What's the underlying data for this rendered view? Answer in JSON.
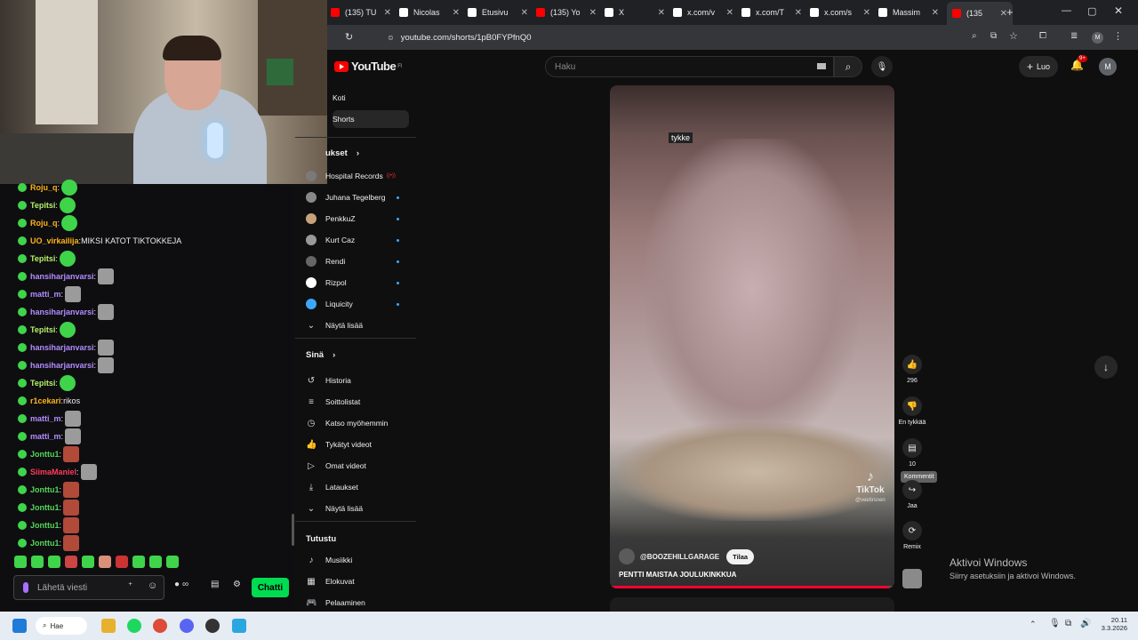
{
  "tabs": [
    {
      "label": "(135) TU",
      "icon": "youtube-icon",
      "color": "#ff0000"
    },
    {
      "label": "Nicolas",
      "icon": "x-icon",
      "color": "#ffffff"
    },
    {
      "label": "Etusivu",
      "icon": "x-icon",
      "color": "#ffffff"
    },
    {
      "label": "(135) Yo",
      "icon": "youtube-icon",
      "color": "#ff0000"
    },
    {
      "label": "X",
      "icon": "x-icon",
      "color": "#ffffff"
    },
    {
      "label": "x.com/v",
      "icon": "x-icon",
      "color": "#ffffff"
    },
    {
      "label": "x.com/T",
      "icon": "x-icon",
      "color": "#ffffff"
    },
    {
      "label": "x.com/s",
      "icon": "x-icon",
      "color": "#ffffff"
    },
    {
      "label": "Massim",
      "icon": "x-icon",
      "color": "#ffffff"
    },
    {
      "label": "(135",
      "icon": "youtube-icon",
      "color": "#ff0000"
    }
  ],
  "address": {
    "url": "youtube.com/shorts/1pB0FYPfnQ0"
  },
  "youtube": {
    "logo": "YouTube",
    "region": "FI",
    "search_placeholder": "Haku",
    "create_label": "Luo",
    "notifications": "9+",
    "avatar_letter": "M",
    "nav": [
      {
        "label": "Koti"
      },
      {
        "label": "Shorts"
      }
    ],
    "subscriptions_title": "ukset",
    "subscriptions": [
      {
        "label": "Hospital Records",
        "live": true
      },
      {
        "label": "Juhana Tegelberg",
        "live": false
      },
      {
        "label": "PenkkuZ",
        "live": false
      },
      {
        "label": "Kurt Caz",
        "live": false
      },
      {
        "label": "Rendi",
        "live": false
      },
      {
        "label": "Rizpol",
        "live": false
      },
      {
        "label": "Liquicity",
        "live": false
      }
    ],
    "show_more": "Näytä lisää",
    "you_title": "Sinä",
    "you_items": [
      {
        "label": "Historia",
        "icon": "history-icon",
        "glyph": "↺"
      },
      {
        "label": "Soittolistat",
        "icon": "playlists-icon",
        "glyph": "≡"
      },
      {
        "label": "Katso myöhemmin",
        "icon": "watch-later-icon",
        "glyph": "◷"
      },
      {
        "label": "Tykätyt videot",
        "icon": "liked-videos-icon",
        "glyph": "👍"
      },
      {
        "label": "Omat videot",
        "icon": "your-videos-icon",
        "glyph": "▷"
      },
      {
        "label": "Lataukset",
        "icon": "downloads-icon",
        "glyph": "⤓"
      },
      {
        "label": "Näytä lisää",
        "icon": "chevron-down-icon",
        "glyph": "⌄"
      }
    ],
    "explore_title": "Tutustu",
    "explore_items": [
      {
        "label": "Musiikki",
        "icon": "music-icon",
        "glyph": "♪"
      },
      {
        "label": "Elokuvat",
        "icon": "movies-icon",
        "glyph": "▦"
      },
      {
        "label": "Pelaaminen",
        "icon": "gaming-icon",
        "glyph": "🎮"
      }
    ],
    "short": {
      "overlay_text": "tykke",
      "channel": "@BOOZEHILLGARAGE",
      "subscribe": "Tilaa",
      "title": "PENTTI MAISTAA JOULUKINKKUA",
      "tiktok": "TikTok",
      "tiktok_handle": "@veetirsnen",
      "progress": 0.98,
      "likes": "296",
      "dislike_label": "En tykkää",
      "comments": "10",
      "comments_tooltip": "Kommentit",
      "share_label": "Jaa",
      "remix_label": "Remix"
    },
    "watermark": {
      "title": "Aktivoi Windows",
      "subtitle": "Siirry asetuksiin ja aktivoi Windows."
    }
  },
  "chat": {
    "messages": [
      {
        "user": "Roju_q",
        "color": "#ffb31a",
        "text": "",
        "emote": "green"
      },
      {
        "user": "Tepitsi",
        "color": "#b7f06a",
        "text": "",
        "emote": "green"
      },
      {
        "user": "Roju_q",
        "color": "#ffb31a",
        "text": "",
        "emote": "green"
      },
      {
        "user": "UO_virkailija",
        "color": "#ffb31a",
        "text": "MIKSI KATOT TIKTOKKEJA",
        "emote": ""
      },
      {
        "user": "Tepitsi",
        "color": "#b7f06a",
        "text": "",
        "emote": "green"
      },
      {
        "user": "hansiharjanvarsi",
        "color": "#b28cff",
        "text": "",
        "emote": "cat"
      },
      {
        "user": "matti_m",
        "color": "#b28cff",
        "text": "",
        "emote": "cat"
      },
      {
        "user": "hansiharjanvarsi",
        "color": "#b28cff",
        "text": "",
        "emote": "cat"
      },
      {
        "user": "Tepitsi",
        "color": "#b7f06a",
        "text": "",
        "emote": "green"
      },
      {
        "user": "hansiharjanvarsi",
        "color": "#b28cff",
        "text": "",
        "emote": "cat"
      },
      {
        "user": "hansiharjanvarsi",
        "color": "#b28cff",
        "text": "",
        "emote": "cat"
      },
      {
        "user": "Tepitsi",
        "color": "#b7f06a",
        "text": "",
        "emote": "green"
      },
      {
        "user": "r1cekari",
        "color": "#ffb31a",
        "text": "rikos",
        "emote": ""
      },
      {
        "user": "matti_m",
        "color": "#b28cff",
        "text": "",
        "emote": "cat"
      },
      {
        "user": "matti_m",
        "color": "#b28cff",
        "text": "",
        "emote": "cat"
      },
      {
        "user": "Jonttu1",
        "color": "#54d65a",
        "text": "",
        "emote": "face"
      },
      {
        "user": "SiimaManiel",
        "color": "#ff3b5c",
        "text": "",
        "emote": "cat"
      },
      {
        "user": "Jonttu1",
        "color": "#54d65a",
        "text": "",
        "emote": "face"
      },
      {
        "user": "Jonttu1",
        "color": "#54d65a",
        "text": "",
        "emote": "face"
      },
      {
        "user": "Jonttu1",
        "color": "#54d65a",
        "text": "",
        "emote": "face"
      },
      {
        "user": "Jonttu1",
        "color": "#54d65a",
        "text": "",
        "emote": "face"
      }
    ],
    "input_placeholder": "Lähetä viesti",
    "send_label": "Chatti",
    "points": "∞"
  },
  "taskbar": {
    "search_label": "Hae",
    "time": "20.11",
    "date": "3.3.2026"
  }
}
